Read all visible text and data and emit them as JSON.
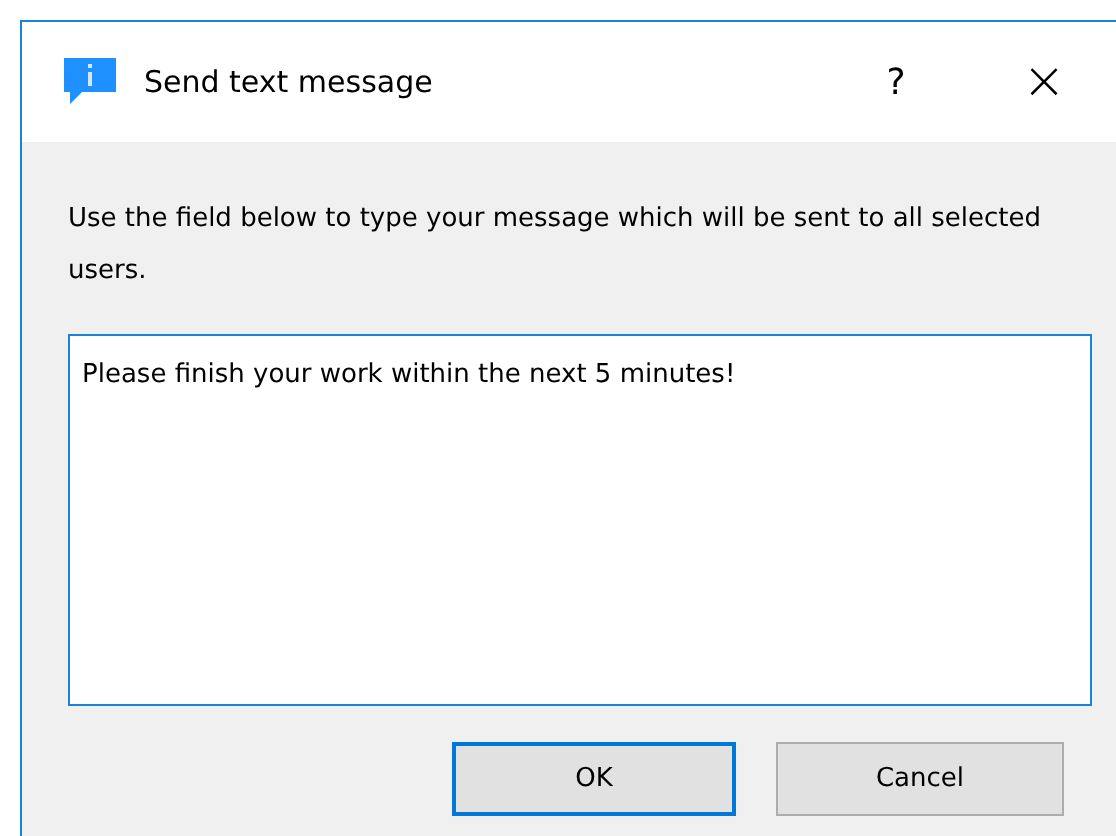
{
  "window": {
    "title": "Send text message",
    "help": "?",
    "close": "×"
  },
  "instructions": "Use the field below to type your message which will be sent to all selected users.",
  "message": {
    "value": "Please finish your work within the next 5 minutes!"
  },
  "buttons": [
    {
      "label": "OK",
      "default": true
    },
    {
      "label": "Cancel",
      "default": false
    }
  ]
}
